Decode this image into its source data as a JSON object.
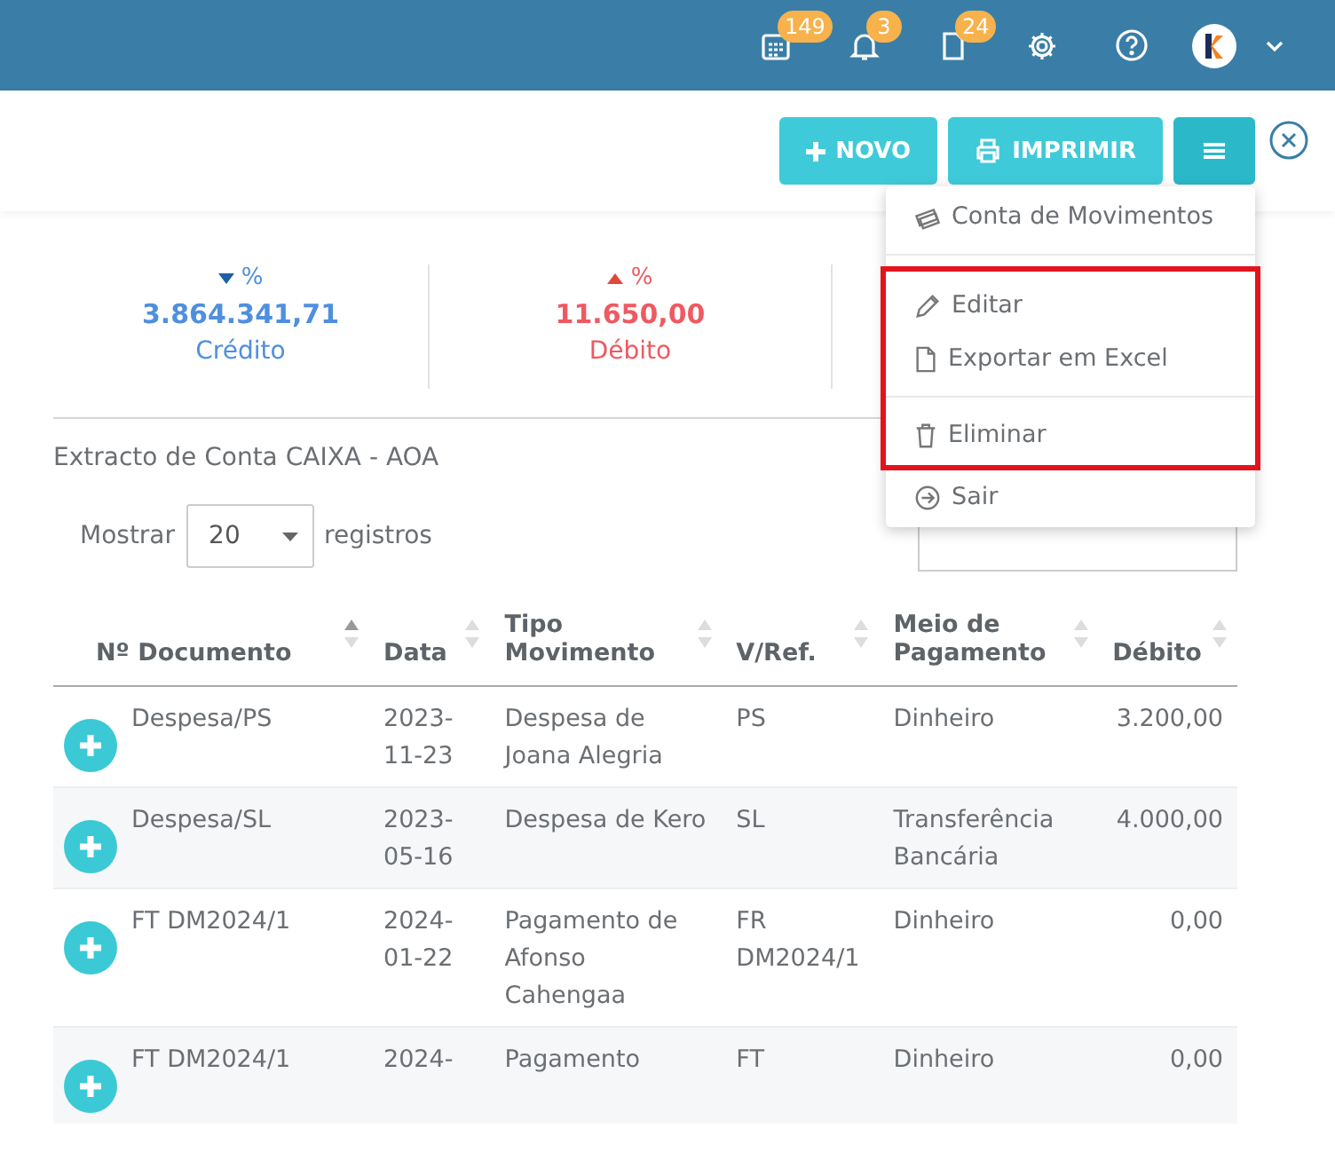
{
  "header": {
    "icons": [
      {
        "kind": "calendar",
        "badge": "149"
      },
      {
        "kind": "bell",
        "badge": "3"
      },
      {
        "kind": "document",
        "badge": "24"
      },
      {
        "kind": "gear"
      },
      {
        "kind": "help"
      },
      {
        "kind": "avatar"
      },
      {
        "kind": "chevron"
      }
    ]
  },
  "toolbar": {
    "buttons": [
      {
        "kind": "new",
        "label": "NOVO"
      },
      {
        "kind": "print",
        "label": "IMPRIMIR"
      },
      {
        "kind": "menu"
      }
    ]
  },
  "menu": {
    "items": [
      {
        "kind": "money",
        "label": "Conta de Movimentos",
        "divider_before": false,
        "highlighted": false
      },
      {
        "kind": "pencil",
        "label": "Editar",
        "divider_before": true,
        "highlighted": true
      },
      {
        "kind": "file",
        "label": "Exportar em Excel",
        "divider_before": false,
        "highlighted": true
      },
      {
        "kind": "trash",
        "label": "Eliminar",
        "divider_before": true,
        "highlighted": true
      },
      {
        "kind": "exit",
        "label": "Sair",
        "divider_before": false,
        "highlighted": false
      }
    ]
  },
  "stats": [
    {
      "kind": "credit",
      "percent": "%",
      "value": "3.864.341,71",
      "label": "Crédito"
    },
    {
      "kind": "debit",
      "percent": "%",
      "value": "11.650,00",
      "label": "Débito"
    }
  ],
  "statement_title": "Extracto de Conta CAIXA - AOA",
  "page_size": {
    "prefix": "Mostrar",
    "value": "20",
    "suffix": "registros"
  },
  "table": {
    "columns": [
      {
        "label": "Nº Documento",
        "sorted": true
      },
      {
        "label": "Data",
        "sorted": false
      },
      {
        "label": "Tipo Movimento",
        "sorted": false
      },
      {
        "label": "V/Ref.",
        "sorted": false
      },
      {
        "label": "Meio de Pagamento",
        "sorted": false
      },
      {
        "label": "Débito",
        "sorted": false
      }
    ],
    "rows": [
      {
        "cells": [
          "Despesa/PS",
          "2023-11-23",
          "Despesa de Joana Alegria",
          "PS",
          "Dinheiro",
          "3.200,00"
        ]
      },
      {
        "cells": [
          "Despesa/SL",
          "2023-05-16",
          "Despesa de Kero",
          "SL",
          "Transferência Bancária",
          "4.000,00"
        ]
      },
      {
        "cells": [
          "FT DM2024/1",
          "2024-01-22",
          "Pagamento de Afonso Cahengaa",
          "FR DM2024/1",
          "Dinheiro",
          "0,00"
        ]
      },
      {
        "cells": [
          "FT DM2024/1",
          "2024-",
          "Pagamento",
          "FT",
          "Dinheiro",
          "0,00"
        ]
      }
    ]
  }
}
